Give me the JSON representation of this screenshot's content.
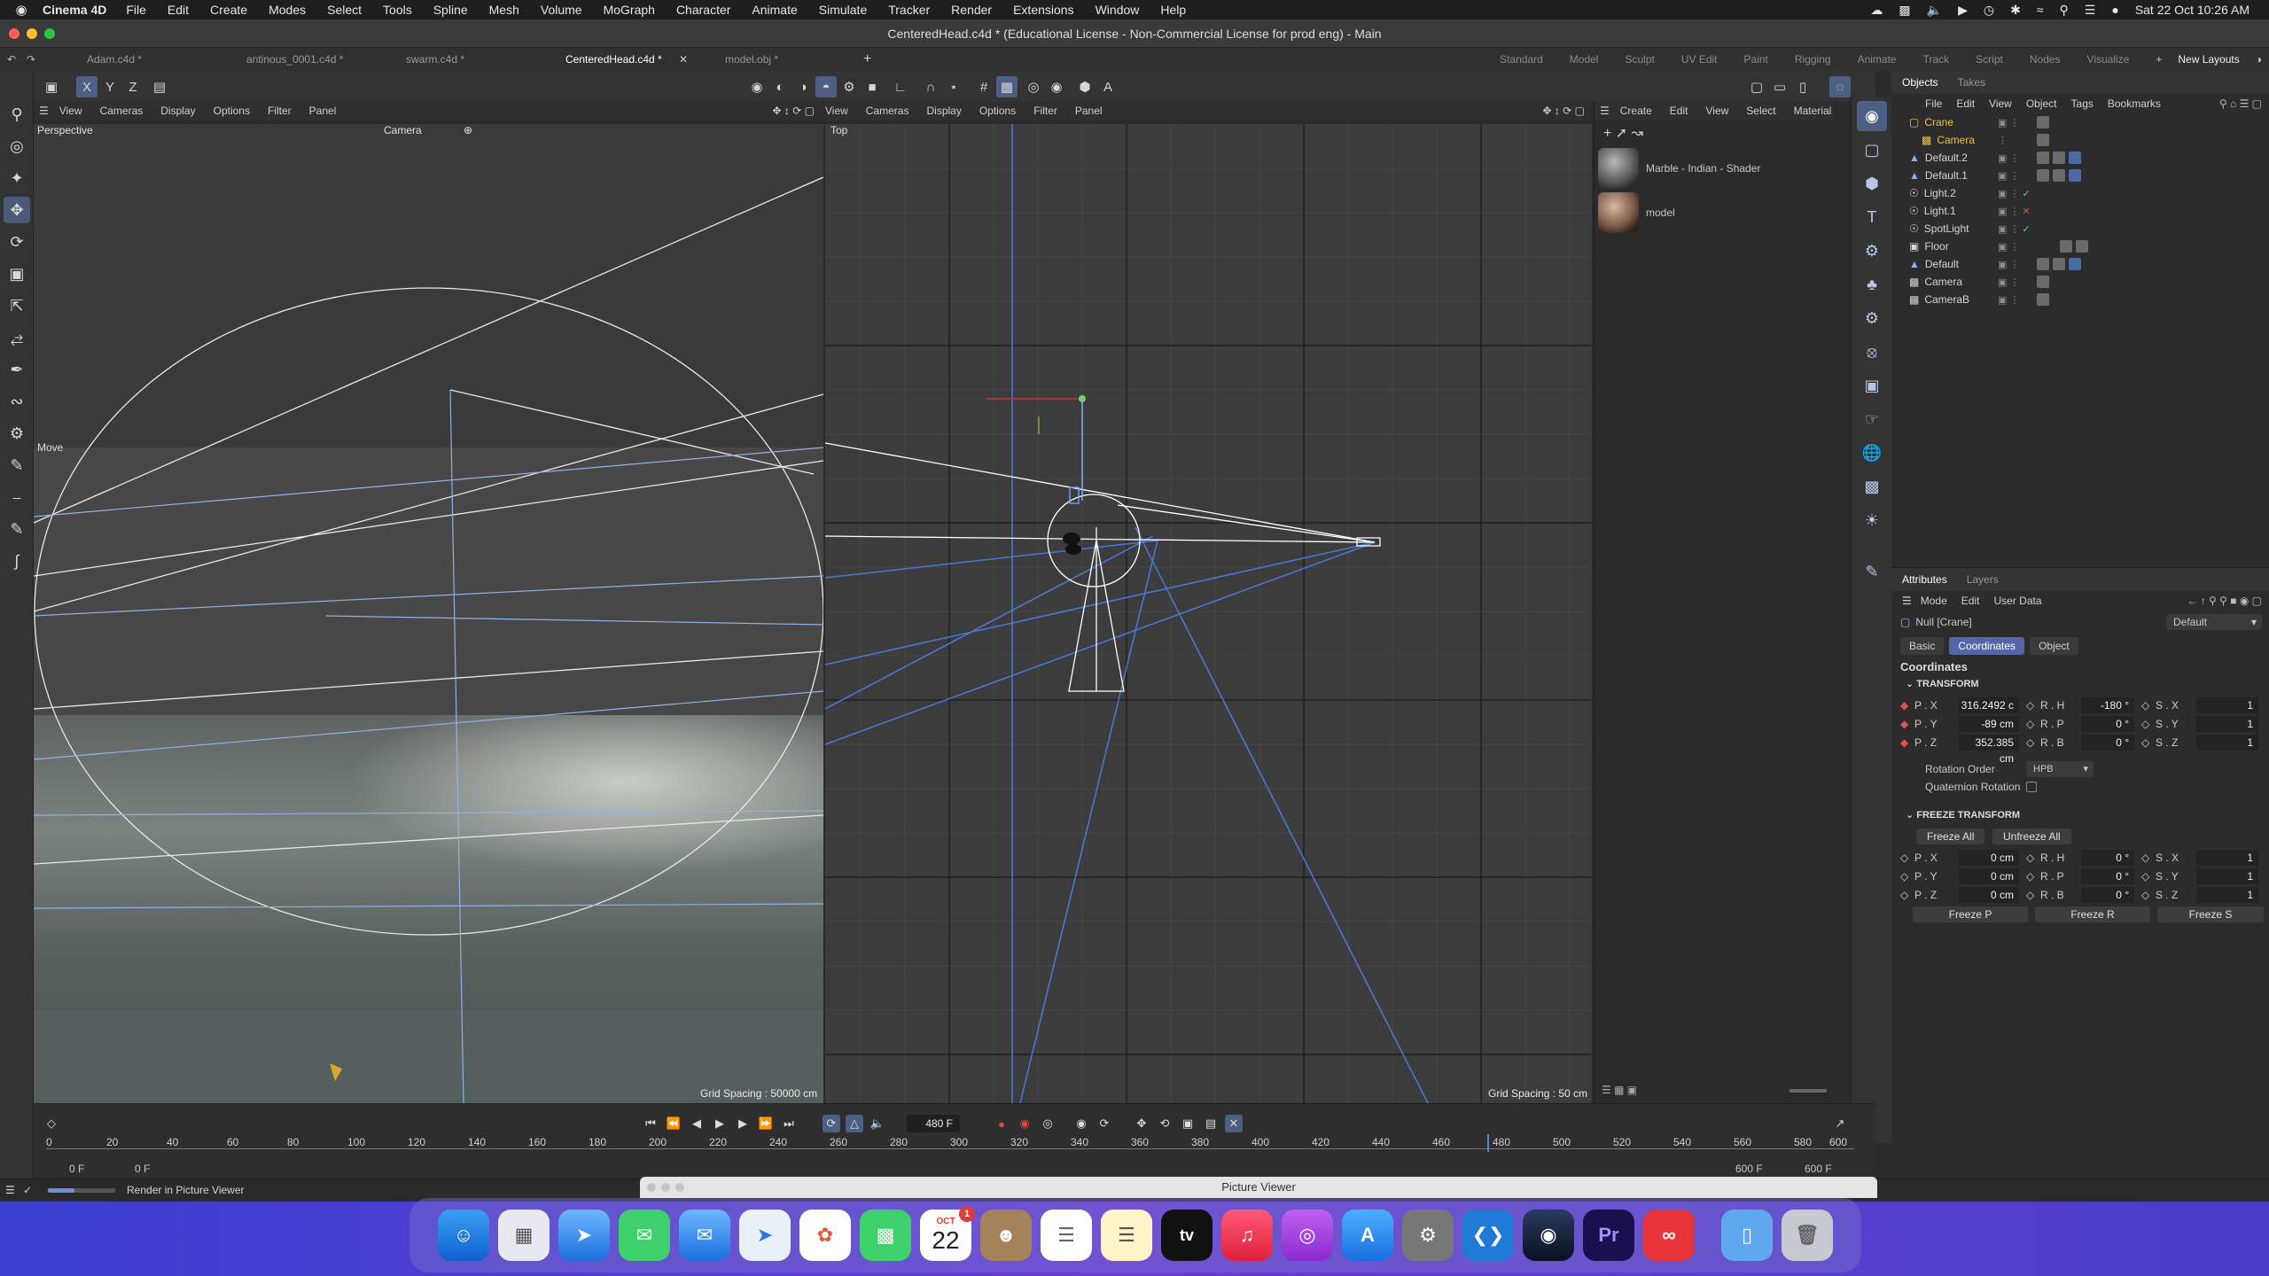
{
  "menubar": {
    "app_name": "Cinema 4D",
    "items": [
      "File",
      "Edit",
      "Create",
      "Modes",
      "Select",
      "Tools",
      "Spline",
      "Mesh",
      "Volume",
      "MoGraph",
      "Character",
      "Animate",
      "Simulate",
      "Tracker",
      "Render",
      "Extensions",
      "Window",
      "Help"
    ],
    "datetime": "Sat 22 Oct  10:26 AM"
  },
  "window": {
    "title": "CenteredHead.c4d * (Educational License - Non-Commercial License for prod eng) - Main"
  },
  "doc_tabs": [
    "Adam.c4d *",
    "antinous_0001.c4d *",
    "swarm.c4d *",
    "CenteredHead.c4d *",
    "model.obj *"
  ],
  "layouts": [
    "Standard",
    "Model",
    "Sculpt",
    "UV Edit",
    "Paint",
    "Rigging",
    "Animate",
    "Track",
    "Script",
    "Nodes",
    "Visualize"
  ],
  "new_layouts": "New Layouts",
  "viewport_left": {
    "menu": [
      "View",
      "Cameras",
      "Display",
      "Options",
      "Filter",
      "Panel"
    ],
    "name": "Perspective",
    "camera": "Camera",
    "tool_label": "Move",
    "grid_spacing": "Grid Spacing : 50000 cm"
  },
  "viewport_right": {
    "menu": [
      "View",
      "Cameras",
      "Display",
      "Options",
      "Filter",
      "Panel"
    ],
    "name": "Top",
    "grid_spacing": "Grid Spacing : 50 cm"
  },
  "material_panel": {
    "menu": [
      "Create",
      "Edit",
      "View",
      "Select",
      "Material"
    ],
    "materials": [
      "Marble - Indian - Shader",
      "model"
    ]
  },
  "objects_panel": {
    "tabs": [
      "Objects",
      "Takes"
    ],
    "menu": [
      "File",
      "Edit",
      "View",
      "Object",
      "Tags",
      "Bookmarks"
    ],
    "objects": [
      {
        "name": "Crane",
        "color": "#f0c040"
      },
      {
        "name": "Camera",
        "color": "#f0c040"
      },
      {
        "name": "Default.2",
        "color": "#d4d4d4"
      },
      {
        "name": "Default.1",
        "color": "#d4d4d4"
      },
      {
        "name": "Light.2",
        "color": "#d4d4d4"
      },
      {
        "name": "Light.1",
        "color": "#d4d4d4"
      },
      {
        "name": "SpotLight",
        "color": "#d4d4d4"
      },
      {
        "name": "Floor",
        "color": "#d4d4d4"
      },
      {
        "name": "Default",
        "color": "#d4d4d4"
      },
      {
        "name": "Camera",
        "color": "#d4d4d4"
      },
      {
        "name": "CameraB",
        "color": "#d4d4d4"
      }
    ]
  },
  "attributes": {
    "tabs": [
      "Attributes",
      "Layers"
    ],
    "menu": [
      "Mode",
      "Edit",
      "User Data"
    ],
    "object_label": "Null [Crane]",
    "preset": "Default",
    "subtabs": [
      "Basic",
      "Coordinates",
      "Object"
    ],
    "section_title": "Coordinates",
    "transform_label": "TRANSFORM",
    "transform": {
      "px": "316.2492 c",
      "py": "-89 cm",
      "pz": "352.385 cm",
      "rh": "-180 °",
      "rp": "0 °",
      "rb": "0 °",
      "sx": "1",
      "sy": "1",
      "sz": "1"
    },
    "labels": {
      "px": "P . X",
      "py": "P . Y",
      "pz": "P . Z",
      "rh": "R . H",
      "rp": "R . P",
      "rb": "R . B",
      "sx": "S . X",
      "sy": "S . Y",
      "sz": "S . Z"
    },
    "rotation_order_label": "Rotation Order",
    "rotation_order": "HPB",
    "quaternion_label": "Quaternion Rotation",
    "freeze_label": "FREEZE TRANSFORM",
    "freeze_all": "Freeze All",
    "unfreeze_all": "Unfreeze All",
    "freeze": {
      "px": "0 cm",
      "py": "0 cm",
      "pz": "0 cm",
      "rh": "0 °",
      "rp": "0 °",
      "rb": "0 °",
      "sx": "1",
      "sy": "1",
      "sz": "1"
    },
    "freeze_p": "Freeze P",
    "freeze_r": "Freeze R",
    "freeze_s": "Freeze S"
  },
  "timeline": {
    "current_frame": "480 F",
    "ticks": [
      "0",
      "20",
      "40",
      "60",
      "80",
      "100",
      "120",
      "140",
      "160",
      "180",
      "200",
      "220",
      "240",
      "260",
      "280",
      "300",
      "320",
      "340",
      "360",
      "380",
      "400",
      "420",
      "440",
      "460",
      "480",
      "500",
      "520",
      "540",
      "560",
      "580",
      "600"
    ],
    "start_a": "0 F",
    "start_b": "0 F",
    "end_a": "600 F",
    "end_b": "600 F",
    "playhead_label": "480"
  },
  "status": {
    "text": "Render in Picture Viewer"
  },
  "picture_viewer": {
    "title": "Picture Viewer"
  },
  "dock": {
    "calendar_month": "OCT",
    "calendar_day": "22",
    "calendar_badge": "1",
    "tv_label": "tv",
    "pr_label": "Pr"
  }
}
